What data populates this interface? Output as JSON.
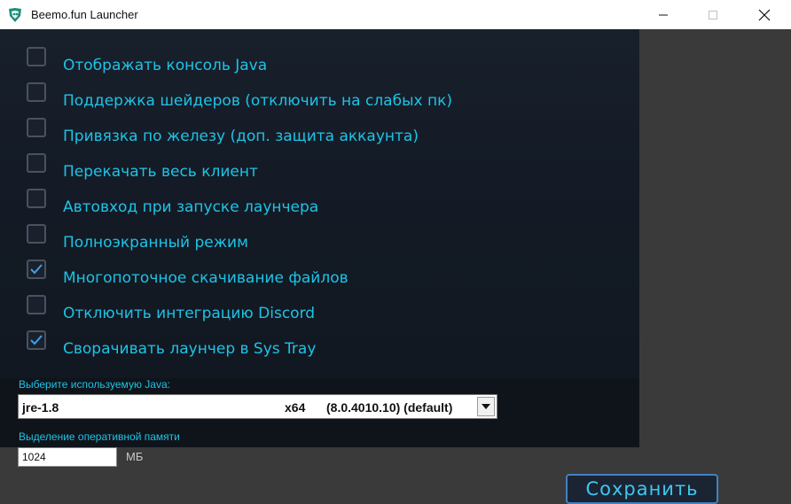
{
  "window": {
    "title": "Beemo.fun Launcher",
    "icon": "beemo-logo-icon"
  },
  "colors": {
    "accent": "#1ec3e6",
    "panel_bg": "#141b26",
    "check": "#3ea0e8"
  },
  "options": [
    {
      "label": "Отображать консоль Java",
      "checked": false
    },
    {
      "label": "Поддержка шейдеров (отключить на слабых пк)",
      "checked": false
    },
    {
      "label": "Привязка по железу (доп. защита аккаунта)",
      "checked": false
    },
    {
      "label": "Перекачать весь клиент",
      "checked": false
    },
    {
      "label": "Автовход при запуске лаунчера",
      "checked": false
    },
    {
      "label": "Полноэкранный режим",
      "checked": false
    },
    {
      "label": "Многопоточное скачивание файлов",
      "checked": true
    },
    {
      "label": "Отключить интеграцию Discord",
      "checked": false
    },
    {
      "label": "Сворачивать лаунчер в Sys Tray",
      "checked": true
    }
  ],
  "java": {
    "label": "Выберите используемую Java:",
    "selected_name": "jre-1.8",
    "selected_arch": "x64",
    "selected_version": "(8.0.4010.10) (default)"
  },
  "ram": {
    "label": "Выделение оперативной памяти",
    "value": "1024",
    "unit": "МБ"
  },
  "save_label": "Сохранить"
}
